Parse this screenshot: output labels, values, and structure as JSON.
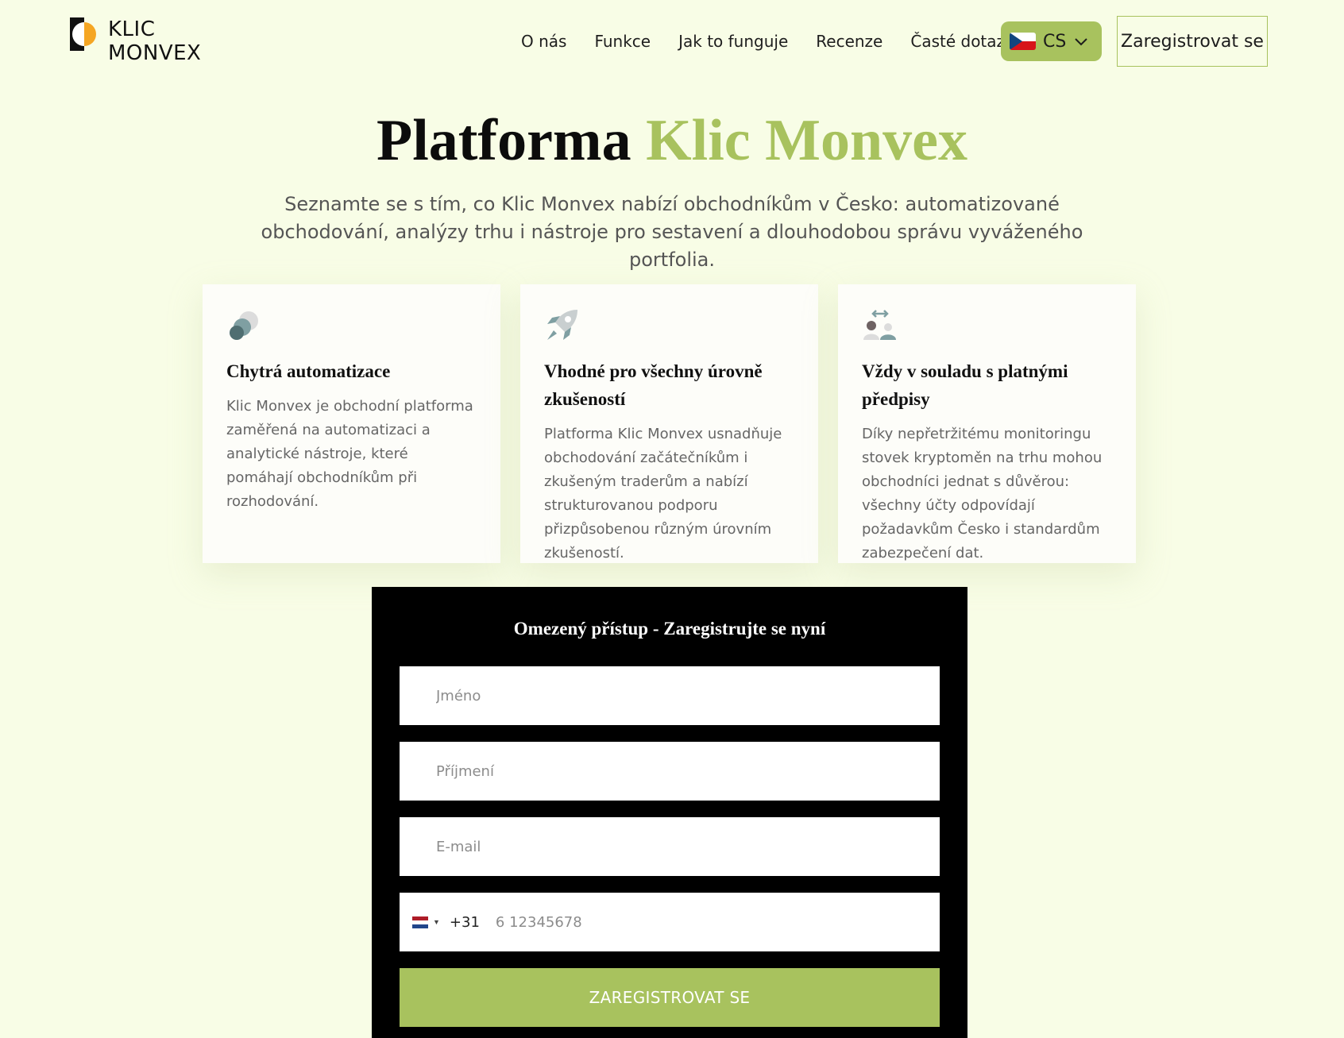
{
  "brand": {
    "line1": "KLIC",
    "line2": "MONVEX",
    "logo_icon": "logo-mark-icon",
    "accent_color": "#a8c25e",
    "logo_orange": "#f5a623"
  },
  "nav": {
    "items": [
      {
        "label": "O nás"
      },
      {
        "label": "Funkce"
      },
      {
        "label": "Jak to funguje"
      },
      {
        "label": "Recenze"
      },
      {
        "label": "Časté dotazy"
      }
    ],
    "language": {
      "code": "CS",
      "flag_icon": "czech-flag-icon",
      "chevron_icon": "chevron-down-icon"
    },
    "register_label": "Zaregistrovat se"
  },
  "hero": {
    "title_main": "Platforma",
    "title_accent": "Klic Monvex",
    "subtitle": "Seznamte se s tím, co Klic Monvex nabízí obchodníkům v Česko: automatizované obchodování, analýzy trhu i nástroje pro sestavení a dlouhodobou správu vyváženého portfolia."
  },
  "features": [
    {
      "icon": "circles-icon",
      "title": "Chytrá automatizace",
      "text": "Klic Monvex je obchodní platforma zaměřená na automatizaci a analytické nástroje, které pomáhají obchodníkům při rozhodování."
    },
    {
      "icon": "rocket-icon",
      "title": "Vhodné pro všechny úrovně zkušeností",
      "text": "Platforma Klic Monvex usnadňuje obchodování začátečníkům i zkušeným traderům a nabízí strukturovanou podporu přizpůsobenou různým úrovním zkušeností."
    },
    {
      "icon": "users-exchange-icon",
      "title": "Vždy v souladu s platnými předpisy",
      "text": "Díky nepřetržitému monitoringu stovek kryptoměn na trhu mohou obchodníci jednat s důvěrou: všechny účty odpovídají požadavkům Česko i standardům zabezpečení dat."
    }
  ],
  "form": {
    "title": "Omezený přístup - Zaregistrujte se nyní",
    "first_name_placeholder": "Jméno",
    "last_name_placeholder": "Příjmení",
    "email_placeholder": "E-mail",
    "phone": {
      "flag_icon": "netherlands-flag-icon",
      "dial_code": "+31",
      "placeholder": "6 12345678"
    },
    "submit_label": "ZAREGISTROVAT SE"
  }
}
